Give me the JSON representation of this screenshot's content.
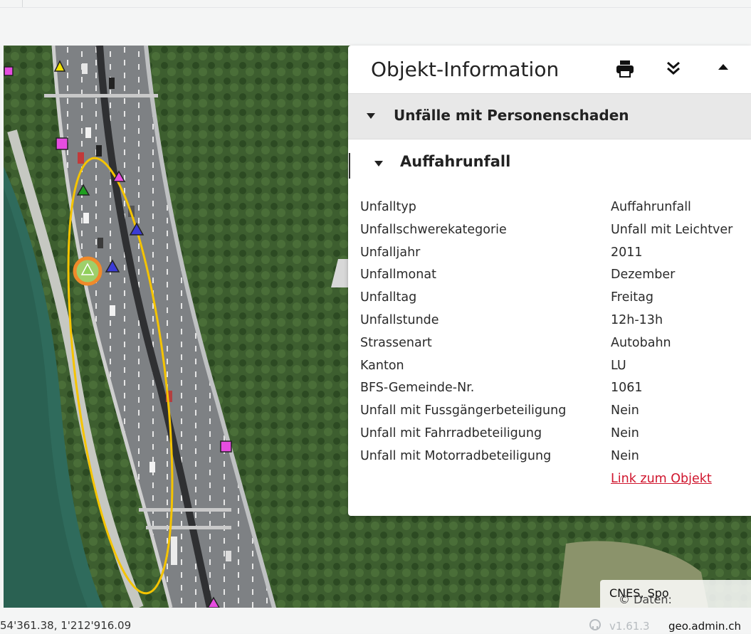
{
  "panel": {
    "title": "Objekt-Information",
    "icons": [
      "print-icon",
      "double-chevron-down-icon",
      "collapse-up-icon"
    ],
    "section_label": "Unfälle mit Personenschaden",
    "sub_label": "Auffahrunfall",
    "rows": [
      {
        "key": "Unfalltyp",
        "value": "Auffahrunfall"
      },
      {
        "key": "Unfallschwerekategorie",
        "value": "Unfall mit Leichtver"
      },
      {
        "key": "Unfalljahr",
        "value": "2011"
      },
      {
        "key": "Unfallmonat",
        "value": "Dezember"
      },
      {
        "key": "Unfalltag",
        "value": "Freitag"
      },
      {
        "key": "Unfallstunde",
        "value": "12h-13h"
      },
      {
        "key": "Strassenart",
        "value": "Autobahn"
      },
      {
        "key": "Kanton",
        "value": "LU"
      },
      {
        "key": "BFS-Gemeinde-Nr.",
        "value": "1061"
      },
      {
        "key": "Unfall mit Fussgängerbeteiligung",
        "value": "Nein"
      },
      {
        "key": "Unfall mit Fahrradbeteiligung",
        "value": "Nein"
      },
      {
        "key": "Unfall mit Motorradbeteiligung",
        "value": "Nein"
      }
    ],
    "link_label": "Link zum Objekt"
  },
  "attribution": {
    "prefix": "© Daten: ",
    "source": "CNES, Spo"
  },
  "footer": {
    "coordinates": "54'361.38, 1'212'916.09",
    "version": "v1.61.3",
    "site": "geo.admin.ch"
  },
  "map": {
    "markers": [
      {
        "shape": "square",
        "color": "#e64de0"
      },
      {
        "shape": "triangle",
        "color": "#f2e200"
      },
      {
        "shape": "square",
        "color": "#e64de0"
      },
      {
        "shape": "triangle",
        "color": "#e64de0"
      },
      {
        "shape": "triangle",
        "color": "#1fa01f"
      },
      {
        "shape": "triangle",
        "color": "#3b3bd6"
      },
      {
        "shape": "triangle",
        "color": "#3b3bd6"
      },
      {
        "shape": "triangle-selected",
        "color": "#8fcf5a"
      },
      {
        "shape": "square",
        "color": "#e64de0"
      },
      {
        "shape": "triangle",
        "color": "#e64de0"
      }
    ],
    "highlight_color": "#f5c400",
    "selection_color": "#f08a2a"
  }
}
